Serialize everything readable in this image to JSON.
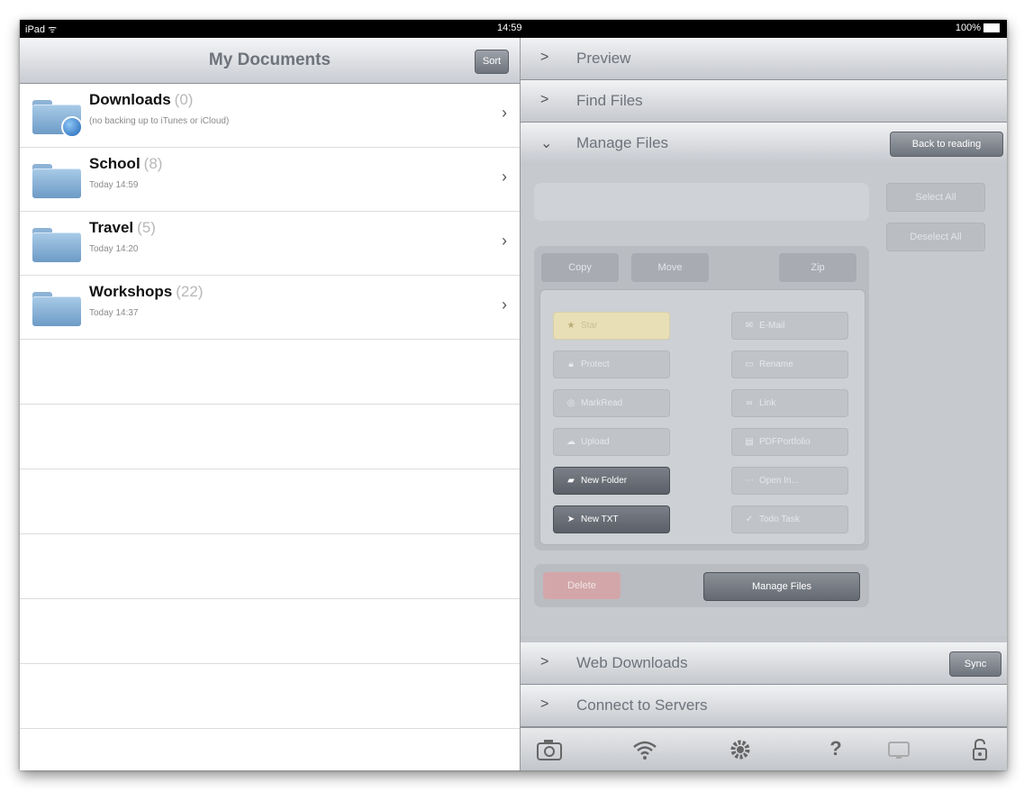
{
  "status_bar": {
    "device": "iPad",
    "time": "14:59",
    "battery": "100%"
  },
  "left": {
    "title": "My Documents",
    "sort_label": "Sort",
    "folders": [
      {
        "name": "Downloads",
        "count": "(0)",
        "sub": "(no backing up to iTunes or iCloud)",
        "icon": "folder-download-icon"
      },
      {
        "name": "School",
        "count": "(8)",
        "sub": "Today 14:59",
        "icon": "folder-icon"
      },
      {
        "name": "Travel",
        "count": "(5)",
        "sub": "Today 14:20",
        "icon": "folder-icon"
      },
      {
        "name": "Workshops",
        "count": "(22)",
        "sub": "Today 14:37",
        "icon": "folder-icon"
      }
    ]
  },
  "right": {
    "preview": "Preview",
    "find_files": "Find Files",
    "manage_files": "Manage Files",
    "back_to_reading": "Back to reading",
    "select_all": "Select All",
    "deselect_all": "Deselect All",
    "tabs": {
      "copy": "Copy",
      "move": "Move",
      "zip": "Zip"
    },
    "actions": {
      "star": "Star",
      "email": "E-Mail",
      "protect": "Protect",
      "rename": "Rename",
      "mark_read": "MarkRead",
      "link": "Link",
      "upload": "Upload",
      "pdf_portfolio": "PDFPortfolio",
      "new_folder": "New Folder",
      "open_in": "Open In...",
      "new_txt": "New TXT",
      "todo_task": "Todo Task"
    },
    "delete": "Delete",
    "manage_files_button": "Manage Files",
    "web_downloads": "Web Downloads",
    "sync": "Sync",
    "connect_servers": "Connect to Servers"
  },
  "toolbar_icons": [
    "camera-icon",
    "wifi-icon",
    "settings-icon",
    "help-icon",
    "display-icon",
    "lock-icon"
  ]
}
